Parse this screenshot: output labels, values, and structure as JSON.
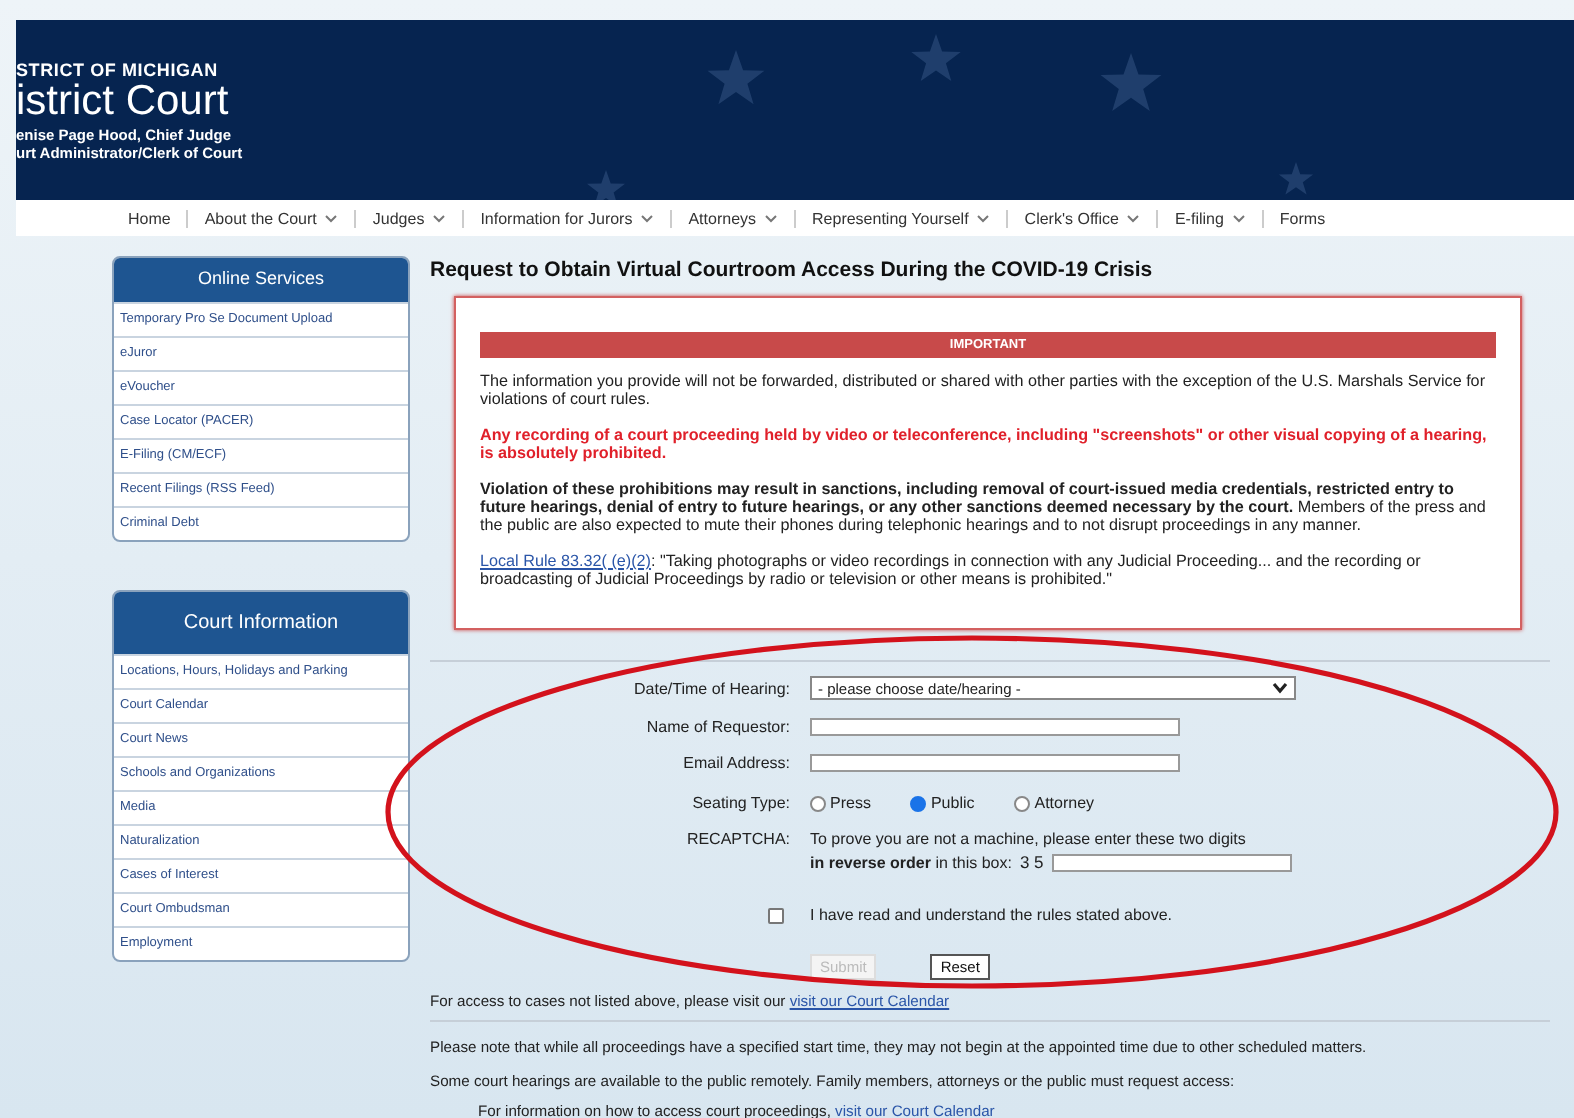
{
  "header": {
    "court_line": "STRICT OF MICHIGAN",
    "title": "istrict Court",
    "judge_line": "enise Page Hood, Chief Judge",
    "clerk_line": "urt Administrator/Clerk of Court"
  },
  "nav": [
    {
      "label": "Home",
      "has_menu": false
    },
    {
      "label": "About the Court",
      "has_menu": true
    },
    {
      "label": "Judges",
      "has_menu": true
    },
    {
      "label": "Information for Jurors",
      "has_menu": true
    },
    {
      "label": "Attorneys",
      "has_menu": true
    },
    {
      "label": "Representing Yourself",
      "has_menu": true
    },
    {
      "label": "Clerk's Office",
      "has_menu": true
    },
    {
      "label": "E-filing",
      "has_menu": true
    },
    {
      "label": "Forms",
      "has_menu": false
    }
  ],
  "sidebar": [
    {
      "title": "Online Services",
      "items": [
        "Temporary Pro Se Document Upload",
        "eJuror",
        "eVoucher",
        "Case Locator (PACER)",
        "E-Filing (CM/ECF)",
        "Recent Filings (RSS Feed)",
        "Criminal Debt"
      ]
    },
    {
      "title": "Court Information",
      "items": [
        "Locations, Hours, Holidays and Parking",
        "Court Calendar",
        "Court News",
        "Schools and Organizations",
        "Media",
        "Naturalization",
        "Cases of Interest",
        "Court Ombudsman",
        "Employment"
      ]
    }
  ],
  "main": {
    "title": "Request to Obtain Virtual Courtroom Access During the COVID-19 Crisis",
    "notice": {
      "heading": "IMPORTANT",
      "paragraphs": [
        {
          "kind": "plain",
          "text": "The information you provide will not be forwarded, distributed or shared with other parties with the exception of the U.S. Marshals Service for violations of court rules."
        },
        {
          "kind": "warning",
          "text": "Any recording of a court proceeding held by video or teleconference, including \"screenshots\" or other visual copying of a hearing, is absolutely prohibited."
        },
        {
          "kind": "plain",
          "text": "**Violation of these prohibitions may result in sanctions, including removal of court-issued media credentials, restricted entry to future hearings, denial of entry to future hearings, or any other sanctions deemed necessary by the court.** Members of the press and the public are also expected to mute their phones during telephonic hearings and to not disrupt proceedings in any manner."
        },
        {
          "kind": "rule",
          "link": "Local Rule 83.32( (e)(2)",
          "text": ": \"Taking photographs or video recordings in connection with any Judicial Proceeding... and the recording or broadcasting of Judicial Proceedings by radio or television or other means is prohibited.\""
        }
      ]
    },
    "form": {
      "fields": [
        {
          "kind": "select",
          "label": "Date/Time of Hearing:",
          "value": "- please choose date/hearing -"
        },
        {
          "kind": "text",
          "label": "Name of Requestor:"
        },
        {
          "kind": "text",
          "label": "Email Address:"
        },
        {
          "kind": "radio",
          "label": "Seating Type:",
          "options": [
            {
              "label": "Press",
              "selected": false
            },
            {
              "label": "Public",
              "selected": true
            },
            {
              "label": "Attorney",
              "selected": false
            }
          ]
        },
        {
          "kind": "captcha",
          "label": "RECAPTCHA:",
          "line1": "To prove you are not a machine, please enter these two digits",
          "line2": "**in reverse order** in this box:",
          "digits": "3 5"
        }
      ],
      "agree": {
        "label": "I have read and understand the rules stated above.",
        "checked": false
      },
      "buttons": [
        {
          "label": "Submit",
          "disabled": true
        },
        {
          "label": "Reset",
          "disabled": false
        }
      ]
    },
    "footer": [
      {
        "text": "For access to cases not listed above, please visit our",
        "link": "visit our Court Calendar",
        "rule_after": true
      },
      {
        "text": "Please note that while all proceedings have a specified start time, they may not begin at the appointed time due to other scheduled matters.",
        "rule_after": false
      },
      {
        "text": "Some court hearings are available to the public remotely. Family members, attorneys or the public must request access:",
        "rule_after": false
      },
      {
        "text": "For information on how to access court proceedings,",
        "link": "visit our Court Calendar",
        "indent": true,
        "rule_after": false
      }
    ]
  }
}
